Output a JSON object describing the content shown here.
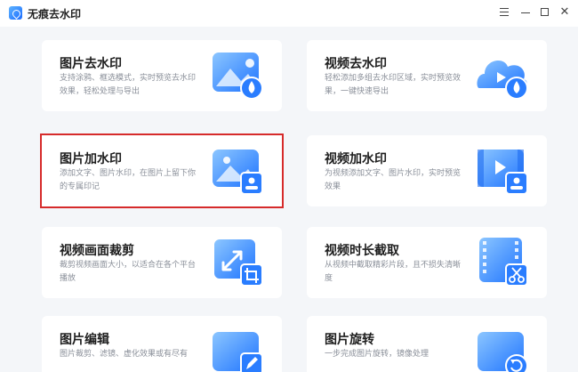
{
  "window": {
    "title": "无痕去水印",
    "controls": [
      "menu-icon",
      "minimize-icon",
      "maximize-icon",
      "close-icon"
    ]
  },
  "cards": [
    {
      "title": "图片去水印",
      "desc": "支持涂鸦、框选模式，实时预览去水印效果，轻松处理与导出",
      "icon": "image-remove-watermark-icon"
    },
    {
      "title": "视频去水印",
      "desc": "轻松添加多组去水印区域，实时预览效果，一键快速导出",
      "icon": "video-remove-watermark-icon"
    },
    {
      "title": "图片加水印",
      "desc": "添加文字、图片水印，在图片上留下你的专属印记",
      "icon": "image-add-watermark-icon",
      "selected": true
    },
    {
      "title": "视频加水印",
      "desc": "为视频添加文字、图片水印，实时预览效果",
      "icon": "video-add-watermark-icon"
    },
    {
      "title": "视频画面裁剪",
      "desc": "裁剪视频画面大小，以适合在各个平台播放",
      "icon": "video-crop-icon"
    },
    {
      "title": "视频时长截取",
      "desc": "从视频中截取精彩片段，且不损失清晰度",
      "icon": "video-trim-icon"
    },
    {
      "title": "图片编辑",
      "desc": "图片裁剪、滤镜、虚化效果或有尽有",
      "icon": "image-edit-icon"
    },
    {
      "title": "图片旋转",
      "desc": "一步完成图片旋转，镜像处理",
      "icon": "image-rotate-icon"
    }
  ],
  "colors": {
    "accent": "#1a6cff",
    "selection": "#d62b2b",
    "background": "#f4f6f9"
  }
}
